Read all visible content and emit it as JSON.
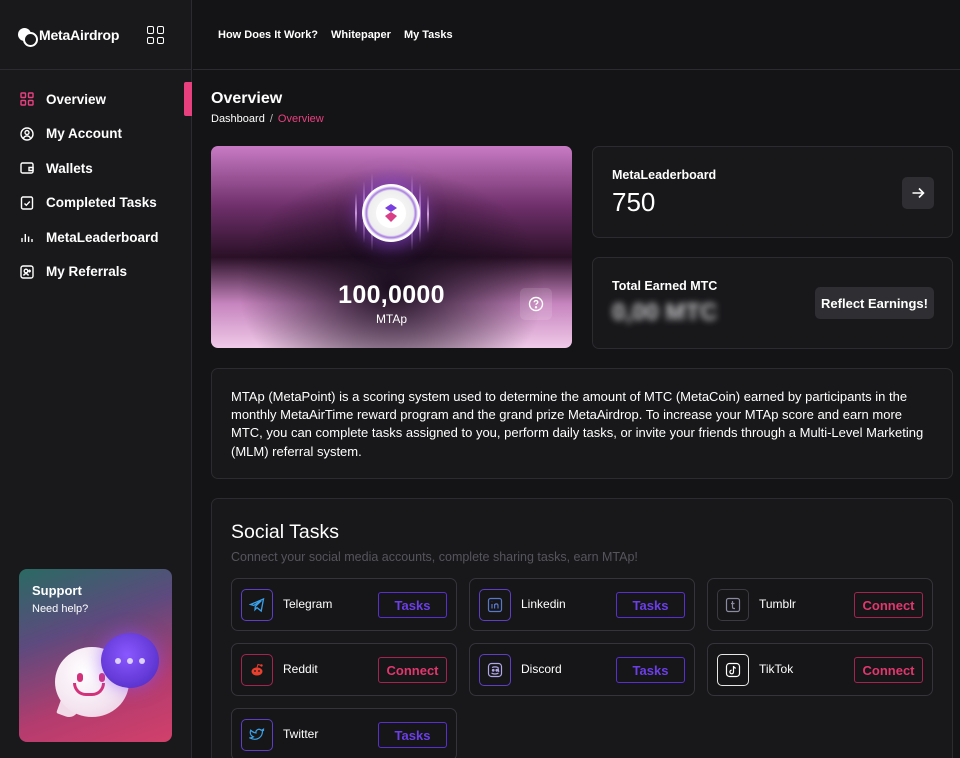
{
  "brand": {
    "name": "MetaAirdrop"
  },
  "header": {
    "links": [
      "How Does It Work?",
      "Whitepaper",
      "My Tasks"
    ]
  },
  "sidebar": {
    "items": [
      {
        "label": "Overview",
        "icon": "grid-icon"
      },
      {
        "label": "My Account",
        "icon": "user-circle-icon"
      },
      {
        "label": "Wallets",
        "icon": "wallet-icon"
      },
      {
        "label": "Completed Tasks",
        "icon": "clipboard-check-icon"
      },
      {
        "label": "MetaLeaderboard",
        "icon": "bar-chart-icon"
      },
      {
        "label": "My Referrals",
        "icon": "referral-icon"
      }
    ],
    "active_index": 0,
    "support": {
      "title": "Support",
      "subtitle": "Need help?"
    }
  },
  "page": {
    "title": "Overview",
    "breadcrumb": {
      "root": "Dashboard",
      "separator": "/",
      "current": "Overview"
    }
  },
  "mtap_card": {
    "value": "100,0000",
    "unit": "MTAp"
  },
  "leaderboard_card": {
    "label": "MetaLeaderboard",
    "value": "750"
  },
  "earned_card": {
    "label": "Total Earned MTC",
    "value": "0,00 MTC",
    "button": "Reflect Earnings!"
  },
  "info_text": "MTAp (MetaPoint) is a scoring system used to determine the amount of MTC (MetaCoin) earned by participants in the monthly MetaAirTime reward program and the grand prize MetaAirdrop. To increase your MTAp score and earn more MTC, you can complete tasks assigned to you, perform daily tasks, or invite your friends through a Multi-Level Marketing (MLM) referral system.",
  "social": {
    "title": "Social Tasks",
    "subtitle": "Connect your social media accounts, complete sharing tasks, earn MTAp!",
    "items": [
      {
        "name": "Telegram",
        "action": "Tasks",
        "icon": "telegram-icon"
      },
      {
        "name": "Linkedin",
        "action": "Tasks",
        "icon": "linkedin-icon"
      },
      {
        "name": "Tumblr",
        "action": "Connect",
        "icon": "tumblr-icon"
      },
      {
        "name": "Reddit",
        "action": "Connect",
        "icon": "reddit-icon"
      },
      {
        "name": "Discord",
        "action": "Tasks",
        "icon": "discord-icon"
      },
      {
        "name": "TikTok",
        "action": "Connect",
        "icon": "tiktok-icon"
      },
      {
        "name": "Twitter",
        "action": "Tasks",
        "icon": "twitter-icon"
      }
    ]
  },
  "colors": {
    "accent": "#e8407f",
    "tasks": "#6b3ee8",
    "connect": "#e0376e",
    "background": "#141416"
  }
}
